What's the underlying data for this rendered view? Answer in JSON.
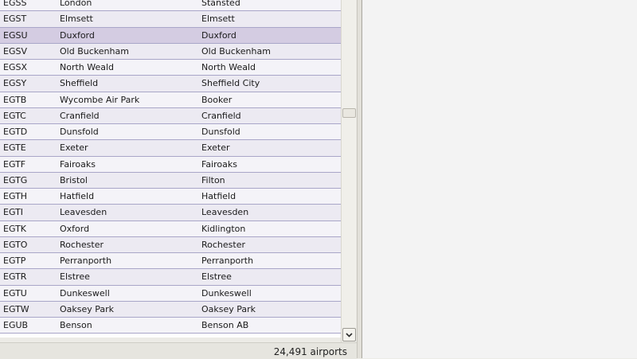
{
  "airports": [
    {
      "icao": "EGSS",
      "name": "London",
      "city": "Stansted"
    },
    {
      "icao": "EGST",
      "name": "Elmsett",
      "city": "Elmsett"
    },
    {
      "icao": "EGSU",
      "name": "Duxford",
      "city": "Duxford",
      "selected": true
    },
    {
      "icao": "EGSV",
      "name": "Old Buckenham",
      "city": "Old Buckenham"
    },
    {
      "icao": "EGSX",
      "name": "North Weald",
      "city": "North Weald"
    },
    {
      "icao": "EGSY",
      "name": "Sheffield",
      "city": "Sheffield City"
    },
    {
      "icao": "EGTB",
      "name": "Wycombe Air Park",
      "city": "Booker"
    },
    {
      "icao": "EGTC",
      "name": "Cranfield",
      "city": "Cranfield"
    },
    {
      "icao": "EGTD",
      "name": "Dunsfold",
      "city": "Dunsfold"
    },
    {
      "icao": "EGTE",
      "name": "Exeter",
      "city": "Exeter"
    },
    {
      "icao": "EGTF",
      "name": "Fairoaks",
      "city": "Fairoaks"
    },
    {
      "icao": "EGTG",
      "name": "Bristol",
      "city": "Filton"
    },
    {
      "icao": "EGTH",
      "name": "Hatfield",
      "city": "Hatfield"
    },
    {
      "icao": "EGTI",
      "name": "Leavesden",
      "city": "Leavesden"
    },
    {
      "icao": "EGTK",
      "name": "Oxford",
      "city": "Kidlington"
    },
    {
      "icao": "EGTO",
      "name": "Rochester",
      "city": "Rochester"
    },
    {
      "icao": "EGTP",
      "name": "Perranporth",
      "city": "Perranporth"
    },
    {
      "icao": "EGTR",
      "name": "Elstree",
      "city": "Elstree"
    },
    {
      "icao": "EGTU",
      "name": "Dunkeswell",
      "city": "Dunkeswell"
    },
    {
      "icao": "EGTW",
      "name": "Oaksey Park",
      "city": "Oaksey Park"
    },
    {
      "icao": "EGUB",
      "name": "Benson",
      "city": "Benson AB"
    }
  ],
  "status": {
    "count_text": "24,491 airports"
  },
  "icons": {
    "scroll_down": "chevron-down-icon"
  }
}
